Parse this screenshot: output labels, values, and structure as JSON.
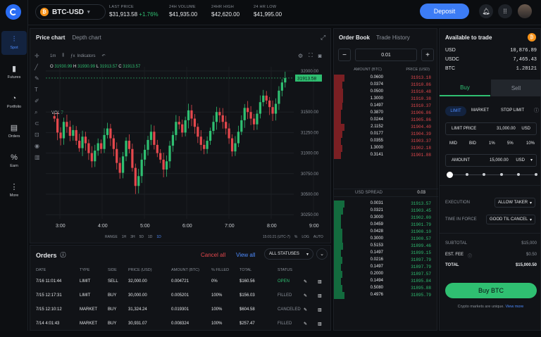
{
  "nav": {
    "items": [
      {
        "label": "Spot"
      },
      {
        "label": "Futures"
      },
      {
        "label": "Portfolio"
      },
      {
        "label": "Orders"
      },
      {
        "label": "Earn"
      },
      {
        "label": "More"
      }
    ]
  },
  "header": {
    "pair": "BTC-USD",
    "last_price_label": "LAST PRICE",
    "last_price": "$31,913.58",
    "change": "+1.76%",
    "volume_label": "24H VOLUME",
    "volume": "$41,935.00",
    "high_label": "24HR HIGH",
    "high": "$42,620.00",
    "low_label": "24 HR LOW",
    "low": "$41,995.00",
    "deposit": "Deposit"
  },
  "chart_panel": {
    "tab_price": "Price chart",
    "tab_depth": "Depth chart",
    "interval": "1m",
    "indicators": "Indicators",
    "ohlc": {
      "o_label": "O",
      "o": "31930.99",
      "h_label": "H",
      "h": "31930.99",
      "l_label": "L",
      "l": "31913.57",
      "c_label": "C",
      "c": "31913.57"
    },
    "vol_label": "VOL",
    "vol": "7",
    "range_label": "RANGE",
    "ranges": [
      "1H",
      "3H",
      "5D",
      "1D",
      "1D"
    ],
    "footer_time": "15:01:21 (UTC-7)",
    "footer_opts": [
      "%",
      "LOG",
      "AUTO"
    ]
  },
  "chart_data": {
    "type": "candlestick",
    "x_ticks": [
      "3:00",
      "4:00",
      "5:00",
      "6:00",
      "7:00",
      "8:00",
      "9:00"
    ],
    "y_ticks": [
      "32000.00",
      "31500.00",
      "31250.00",
      "31000.00",
      "30750.00",
      "30500.00",
      "30250.00"
    ],
    "y_range": [
      30200,
      32050
    ],
    "last_price_label": "31913.58",
    "up_color": "#2fbf71",
    "down_color": "#e5484d",
    "closes": [
      31420,
      31250,
      31180,
      31380,
      31320,
      31210,
      31280,
      31150,
      31060,
      31200,
      31120,
      31000,
      30900,
      31030,
      31120,
      31050,
      31220,
      31300,
      31180,
      31050,
      30880,
      30760,
      30960,
      31150,
      31050,
      30820,
      30600,
      30720,
      30920,
      31040,
      31160,
      31260,
      31100,
      31000,
      30920,
      30800,
      30900,
      31090,
      31220,
      31380,
      31350,
      31250,
      31400,
      31520,
      31420,
      31320,
      31200,
      31100,
      31050,
      31150,
      31270,
      31380,
      31500,
      31460,
      31380,
      31300,
      31180,
      31020,
      31120,
      31260,
      31400,
      31550,
      31500,
      31420,
      31350,
      31480,
      31620,
      31700,
      31640,
      31560,
      31480,
      31600,
      31760,
      31860,
      31913
    ]
  },
  "orders": {
    "title": "Orders",
    "cancel_all": "Cancel all",
    "view_all": "View all",
    "filter": "ALL STATUSES",
    "columns": [
      "DATE",
      "TYPE",
      "SIDE",
      "PRICE (USD)",
      "AMOUNT (BTC)",
      "% FILLED",
      "TOTAL",
      "STATUS"
    ],
    "rows": [
      {
        "date": "7/16 11:01:44",
        "type": "LIMIT",
        "side": "SELL",
        "price": "32,000.00",
        "amount": "0.004721",
        "filled": "0%",
        "total": "$160.56",
        "status": "OPEN"
      },
      {
        "date": "7/15 12:17:31",
        "type": "LIMIT",
        "side": "BUY",
        "price": "30,000.00",
        "amount": "0.005201",
        "filled": "100%",
        "total": "$156.03",
        "status": "FILLED"
      },
      {
        "date": "7/15 12:10:12",
        "type": "MARKET",
        "side": "BUY",
        "price": "31,324.24",
        "amount": "0.019301",
        "filled": "100%",
        "total": "$604.58",
        "status": "CANCELED"
      },
      {
        "date": "7/14 4:01:43",
        "type": "MARKET",
        "side": "BUY",
        "price": "30,931.07",
        "amount": "0.008324",
        "filled": "100%",
        "total": "$257.47",
        "status": "FILLED"
      }
    ]
  },
  "book": {
    "tab_book": "Order Book",
    "tab_history": "Trade History",
    "step": "0.01",
    "col_amount": "AMOUNT (BTC)",
    "col_price": "PRICE (USD)",
    "asks": [
      {
        "amount": "0.0600",
        "price": "31913.18",
        "depth": 0.1
      },
      {
        "amount": "0.0374",
        "price": "31910.86",
        "depth": 0.08
      },
      {
        "amount": "0.0500",
        "price": "31910.48",
        "depth": 0.09
      },
      {
        "amount": "1.3000",
        "price": "31910.38",
        "depth": 0.09
      },
      {
        "amount": "0.1497",
        "price": "31910.37",
        "depth": 0.08
      },
      {
        "amount": "0.3870",
        "price": "31906.86",
        "depth": 0.07
      },
      {
        "amount": "0.0244",
        "price": "31905.86",
        "depth": 0.07
      },
      {
        "amount": "2.1152",
        "price": "31904.40",
        "depth": 0.1
      },
      {
        "amount": "0.0177",
        "price": "31904.39",
        "depth": 0.08
      },
      {
        "amount": "0.0355",
        "price": "31903.37",
        "depth": 0.07
      },
      {
        "amount": "1.3000",
        "price": "31902.18",
        "depth": 0.08
      },
      {
        "amount": "0.3141",
        "price": "31901.88",
        "depth": 0.07
      }
    ],
    "spread_label": "USD SPREAD",
    "spread": "0.03",
    "bids": [
      {
        "amount": "0.0031",
        "price": "31913.57",
        "depth": 0.1
      },
      {
        "amount": "0.0321",
        "price": "31903.45",
        "depth": 0.09
      },
      {
        "amount": "0.3000",
        "price": "31902.00",
        "depth": 0.07
      },
      {
        "amount": "0.0459",
        "price": "31901.79",
        "depth": 0.07
      },
      {
        "amount": "0.0428",
        "price": "31900.10",
        "depth": 0.08
      },
      {
        "amount": "0.3000",
        "price": "31900.57",
        "depth": 0.08
      },
      {
        "amount": "0.5153",
        "price": "31899.46",
        "depth": 0.09
      },
      {
        "amount": "0.1497",
        "price": "31899.15",
        "depth": 0.07
      },
      {
        "amount": "0.0216",
        "price": "31897.79",
        "depth": 0.08
      },
      {
        "amount": "0.1497",
        "price": "31897.79",
        "depth": 0.07
      },
      {
        "amount": "0.2000",
        "price": "31897.57",
        "depth": 0.08
      },
      {
        "amount": "0.1494",
        "price": "31895.84",
        "depth": 0.07
      },
      {
        "amount": "0.5080",
        "price": "31895.88",
        "depth": 0.08
      },
      {
        "amount": "0.4976",
        "price": "31895.79",
        "depth": 0.1
      }
    ]
  },
  "trade": {
    "available_label": "Available to trade",
    "balances": [
      {
        "asset": "USD",
        "value": "10,876.89"
      },
      {
        "asset": "USDC",
        "value": "7,465.43"
      },
      {
        "asset": "BTC",
        "value": "1.28121"
      }
    ],
    "buy": "Buy",
    "sell": "Sell",
    "order_types": [
      "LIMIT",
      "MARKET",
      "STOP LIMIT"
    ],
    "limit_price_label": "LIMIT PRICE",
    "limit_price": "31,000.00",
    "limit_ccy": "USD",
    "quick": [
      "MID",
      "BID",
      "1%",
      "5%",
      "10%"
    ],
    "amount_label": "AMOUNT",
    "amount": "15,000.00",
    "amount_ccy": "USD",
    "slider_level": 0,
    "execution_label": "EXECUTION",
    "execution": "ALLOW TAKER",
    "tif_label": "TIME IN FORCE",
    "tif": "GOOD TIL CANCEL",
    "subtotal_label": "SUBTOTAL",
    "subtotal": "$15,000",
    "fee_label": "EST. FEE",
    "fee": "$0.50",
    "total_label": "TOTAL",
    "total": "$15,000.50",
    "buy_button": "Buy BTC",
    "disclaimer": "Crypto markets are unique.",
    "view_more": "View more"
  }
}
